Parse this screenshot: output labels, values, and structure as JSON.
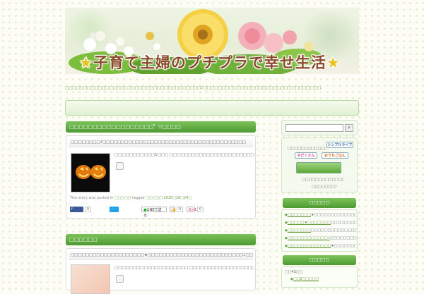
{
  "header": {
    "title": "子育て主婦のプチプラで幸せ生活",
    "tagline": "□□□□□□□□□□□□□□□□□□□□□□□□□□□□□□□□□□□□□♪□□□□□□□□□□□□□□□□□□□□□□□□□□□□□□□□."
  },
  "colors": {
    "accent": "#5aa83a",
    "link": "#6a9a3a",
    "header_text": "#8a4a2a"
  },
  "post1": {
    "section_title": "□□□□□□□□□□□□□□□□□□゜▽□□□□",
    "card_title": "□□□□□□□□♪□□□□□□□□□□□□□□□□□□□□□□□□□□□□□□□□□□□□□□□",
    "excerpt": "□□□□□□□□□□□1□□□ □□□□□□□□□□□□□□□□□□□□□□□□□□□□□□□□□□□□□□□□□ □□□□□□□□□□□",
    "meta_prefix": "This entry was posted in",
    "meta_category": "□□□□□",
    "meta_tagged": "tagged",
    "meta_tag": "□□□□□",
    "meta_date": "2015□10□24□",
    "share_fb_label": "f",
    "share_fb_count": "0",
    "share_tw_label": "",
    "share_line_label": "LINEで送る",
    "share_like_count": "0",
    "share_gplus_label": "G+1",
    "share_gplus_count": "0",
    "thumb_icon": "jack-o-lantern-image"
  },
  "post2": {
    "section_title": "□□□□□□",
    "card_title": "□□□□□□□□□□□□□□□□□□□□★□□□□□□□□□□□□□□□□□□□□□□□□□□♪□□□□□□□□□□□",
    "excerpt": "□□□□□□□□□□□□□□□□□□□□ □□□□□□□□□□□□□□□□□□□□□□□□□□□□□□□□□□□□□ □□□□□□□□□□□□□"
  },
  "sidebar": {
    "search_placeholder": "",
    "search_icon": "search-icon",
    "ranking_caption": "□□□□□□□□□□□□□",
    "ranking_btn1": "シンプルライフ",
    "ranking_btn2": "子だくさん",
    "ranking_btn3": "おうちごはん",
    "ranking_text1": "□□□□□□□□□□□□□□□",
    "ranking_text2": "□□□□□□□♪",
    "box1_title": "□□□□□",
    "box1_items": [
      {
        "link": "□□□□□□□",
        "text": "★□□□□□□□□□□□□□□□□"
      },
      {
        "link": "□□□□□★□□□□□□□",
        "text": "□□□□□□□□□□□□□□□"
      },
      {
        "link": "□□□□□□□",
        "text": "□□□□□□□□□□□□□□□□□□□□□□□□"
      },
      {
        "link": "□□□□□□□□□□□□♪",
        "text": "□□□□□□□□□□□□□□□□"
      },
      {
        "link": "□□□□□□□□□□□□□",
        "text": "★□□□□□□□□□□□□♪□"
      }
    ],
    "box2_title": "□□□□□",
    "archive1": "□□43□□",
    "archive2": "□□2□□□□□"
  }
}
